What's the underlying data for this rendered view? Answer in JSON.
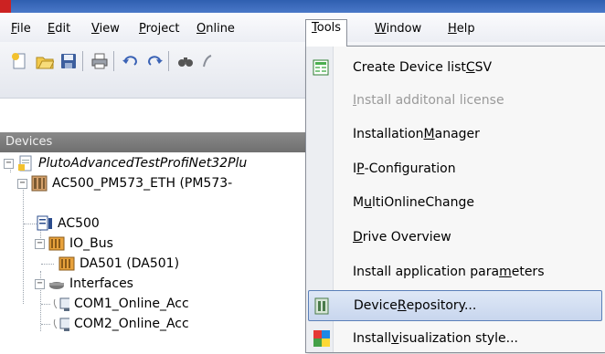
{
  "menubar": {
    "items": [
      {
        "pre": "",
        "u": "F",
        "post": "ile"
      },
      {
        "pre": "",
        "u": "E",
        "post": "dit"
      },
      {
        "pre": "",
        "u": "V",
        "post": "iew"
      },
      {
        "pre": "",
        "u": "P",
        "post": "roject"
      },
      {
        "pre": "",
        "u": "O",
        "post": "nline"
      },
      {
        "pre": "",
        "u": "T",
        "post": "ools"
      },
      {
        "pre": "",
        "u": "W",
        "post": "indow"
      },
      {
        "pre": "",
        "u": "H",
        "post": "elp"
      }
    ]
  },
  "devices_panel": {
    "title": "Devices"
  },
  "tree": {
    "root": "PlutoAdvancedTestProfiNet32Plu",
    "plc": "AC500_PM573_ETH (PM573-",
    "ac500": "AC500",
    "io_bus": "IO_Bus",
    "da501": "DA501 (DA501)",
    "interfaces": "Interfaces",
    "com1": "COM1_Online_Acc",
    "com2": "COM2_Online_Acc"
  },
  "tools_menu": {
    "items": [
      {
        "pre": "Create Device list ",
        "u": "C",
        "post": "SV",
        "enabled": true
      },
      {
        "pre": "",
        "u": "I",
        "post": "nstall additonal license",
        "enabled": false
      },
      {
        "pre": "Installation ",
        "u": "M",
        "post": "anager",
        "enabled": true
      },
      {
        "pre": "I",
        "u": "P",
        "post": "-Configuration",
        "enabled": true
      },
      {
        "pre": "M",
        "u": "u",
        "post": "ltiOnlineChange",
        "enabled": true
      },
      {
        "pre": "",
        "u": "D",
        "post": "rive Overview",
        "enabled": true
      },
      {
        "pre": "Install application para",
        "u": "m",
        "post": "eters",
        "enabled": true
      },
      {
        "pre": "Device ",
        "u": "R",
        "post": "epository...",
        "enabled": true
      },
      {
        "pre": "Install ",
        "u": "v",
        "post": "isualization style...",
        "enabled": true
      }
    ],
    "highlighted_index": 7
  },
  "colors": {
    "menu_highlight": "#c8d6ee",
    "highlight_border": "#5a7fb8",
    "devices_header": "#7a7a7a",
    "disabled_text": "#9a9a9a"
  }
}
